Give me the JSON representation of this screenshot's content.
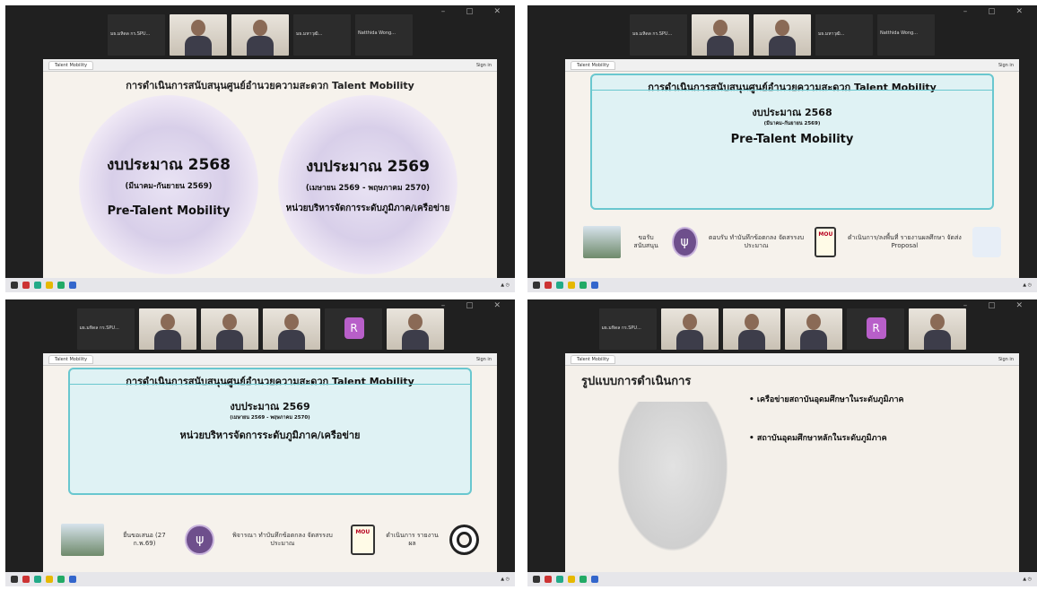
{
  "panels": [
    {
      "participants": [
        "มธ.มหิดล กร.SPU...",
        "",
        "",
        "มธ.มหาวุฒิ...",
        "Natthida Wong..."
      ],
      "slide": {
        "title": "การดำเนินการสนับสนุนศูนย์อำนวยความสะดวก Talent Mobility",
        "left": {
          "budget": "งบประมาณ 2568",
          "period": "(มีนาคม-กันยายน 2569)",
          "program": "Pre-Talent Mobility"
        },
        "right": {
          "budget": "งบประมาณ 2569",
          "period": "(เมษายน 2569 - พฤษภาคม 2570)",
          "program": "หน่วยบริหารจัดการระดับภูมิภาค/เครือข่าย"
        }
      }
    },
    {
      "participants": [
        "มธ.มหิดล กร.SPU...",
        "",
        "",
        "มธ.มหาวุฒิ...",
        "Natthida Wong..."
      ],
      "slide": {
        "title": "การดำเนินการสนับสนุนศูนย์อำนวยความสะดวก Talent Mobility",
        "budget": "งบประมาณ 2568",
        "period": "(มีนาคม-กันยายน 2569)",
        "program": "Pre-Talent Mobility",
        "steps": [
          "ขอรับสนับสนุน",
          "ตอบรับ ทำบันทึกข้อตกลง จัดสรรงบประมาณ",
          "ดำเนินการ/ลงพื้นที่ รายงานผลศึกษา จัดส่ง Proposal"
        ]
      }
    },
    {
      "participants": [
        "มธ.มหิดล กร.SPU...",
        "",
        "",
        "",
        "R",
        ""
      ],
      "slide": {
        "title": "การดำเนินการสนับสนุนศูนย์อำนวยความสะดวก Talent Mobility",
        "budget": "งบประมาณ 2569",
        "period": "(เมษายน 2569 - พฤษภาคม 2570)",
        "program": "หน่วยบริหารจัดการระดับภูมิภาค/เครือข่าย",
        "steps": [
          "ยื่นขอเสนอ (27 ก.พ.69)",
          "พิจารณา ทำบันทึกข้อตกลง จัดสรรงบประมาณ",
          "ดำเนินการ รายงานผล"
        ]
      }
    },
    {
      "participants": [
        "มธ.มหิดล กร.SPU...",
        "",
        "",
        "",
        "R",
        ""
      ],
      "slide": {
        "title": "รูปแบบการดำเนินการ",
        "h1": "เครือข่ายสถาบันอุดมศึกษาในระดับภูมิภาค",
        "h2": "สถาบันอุดมศึกษาหลักในระดับภูมิภาค"
      }
    }
  ],
  "browser": {
    "tab": "Talent Mobility",
    "sign_in": "Sign in"
  }
}
